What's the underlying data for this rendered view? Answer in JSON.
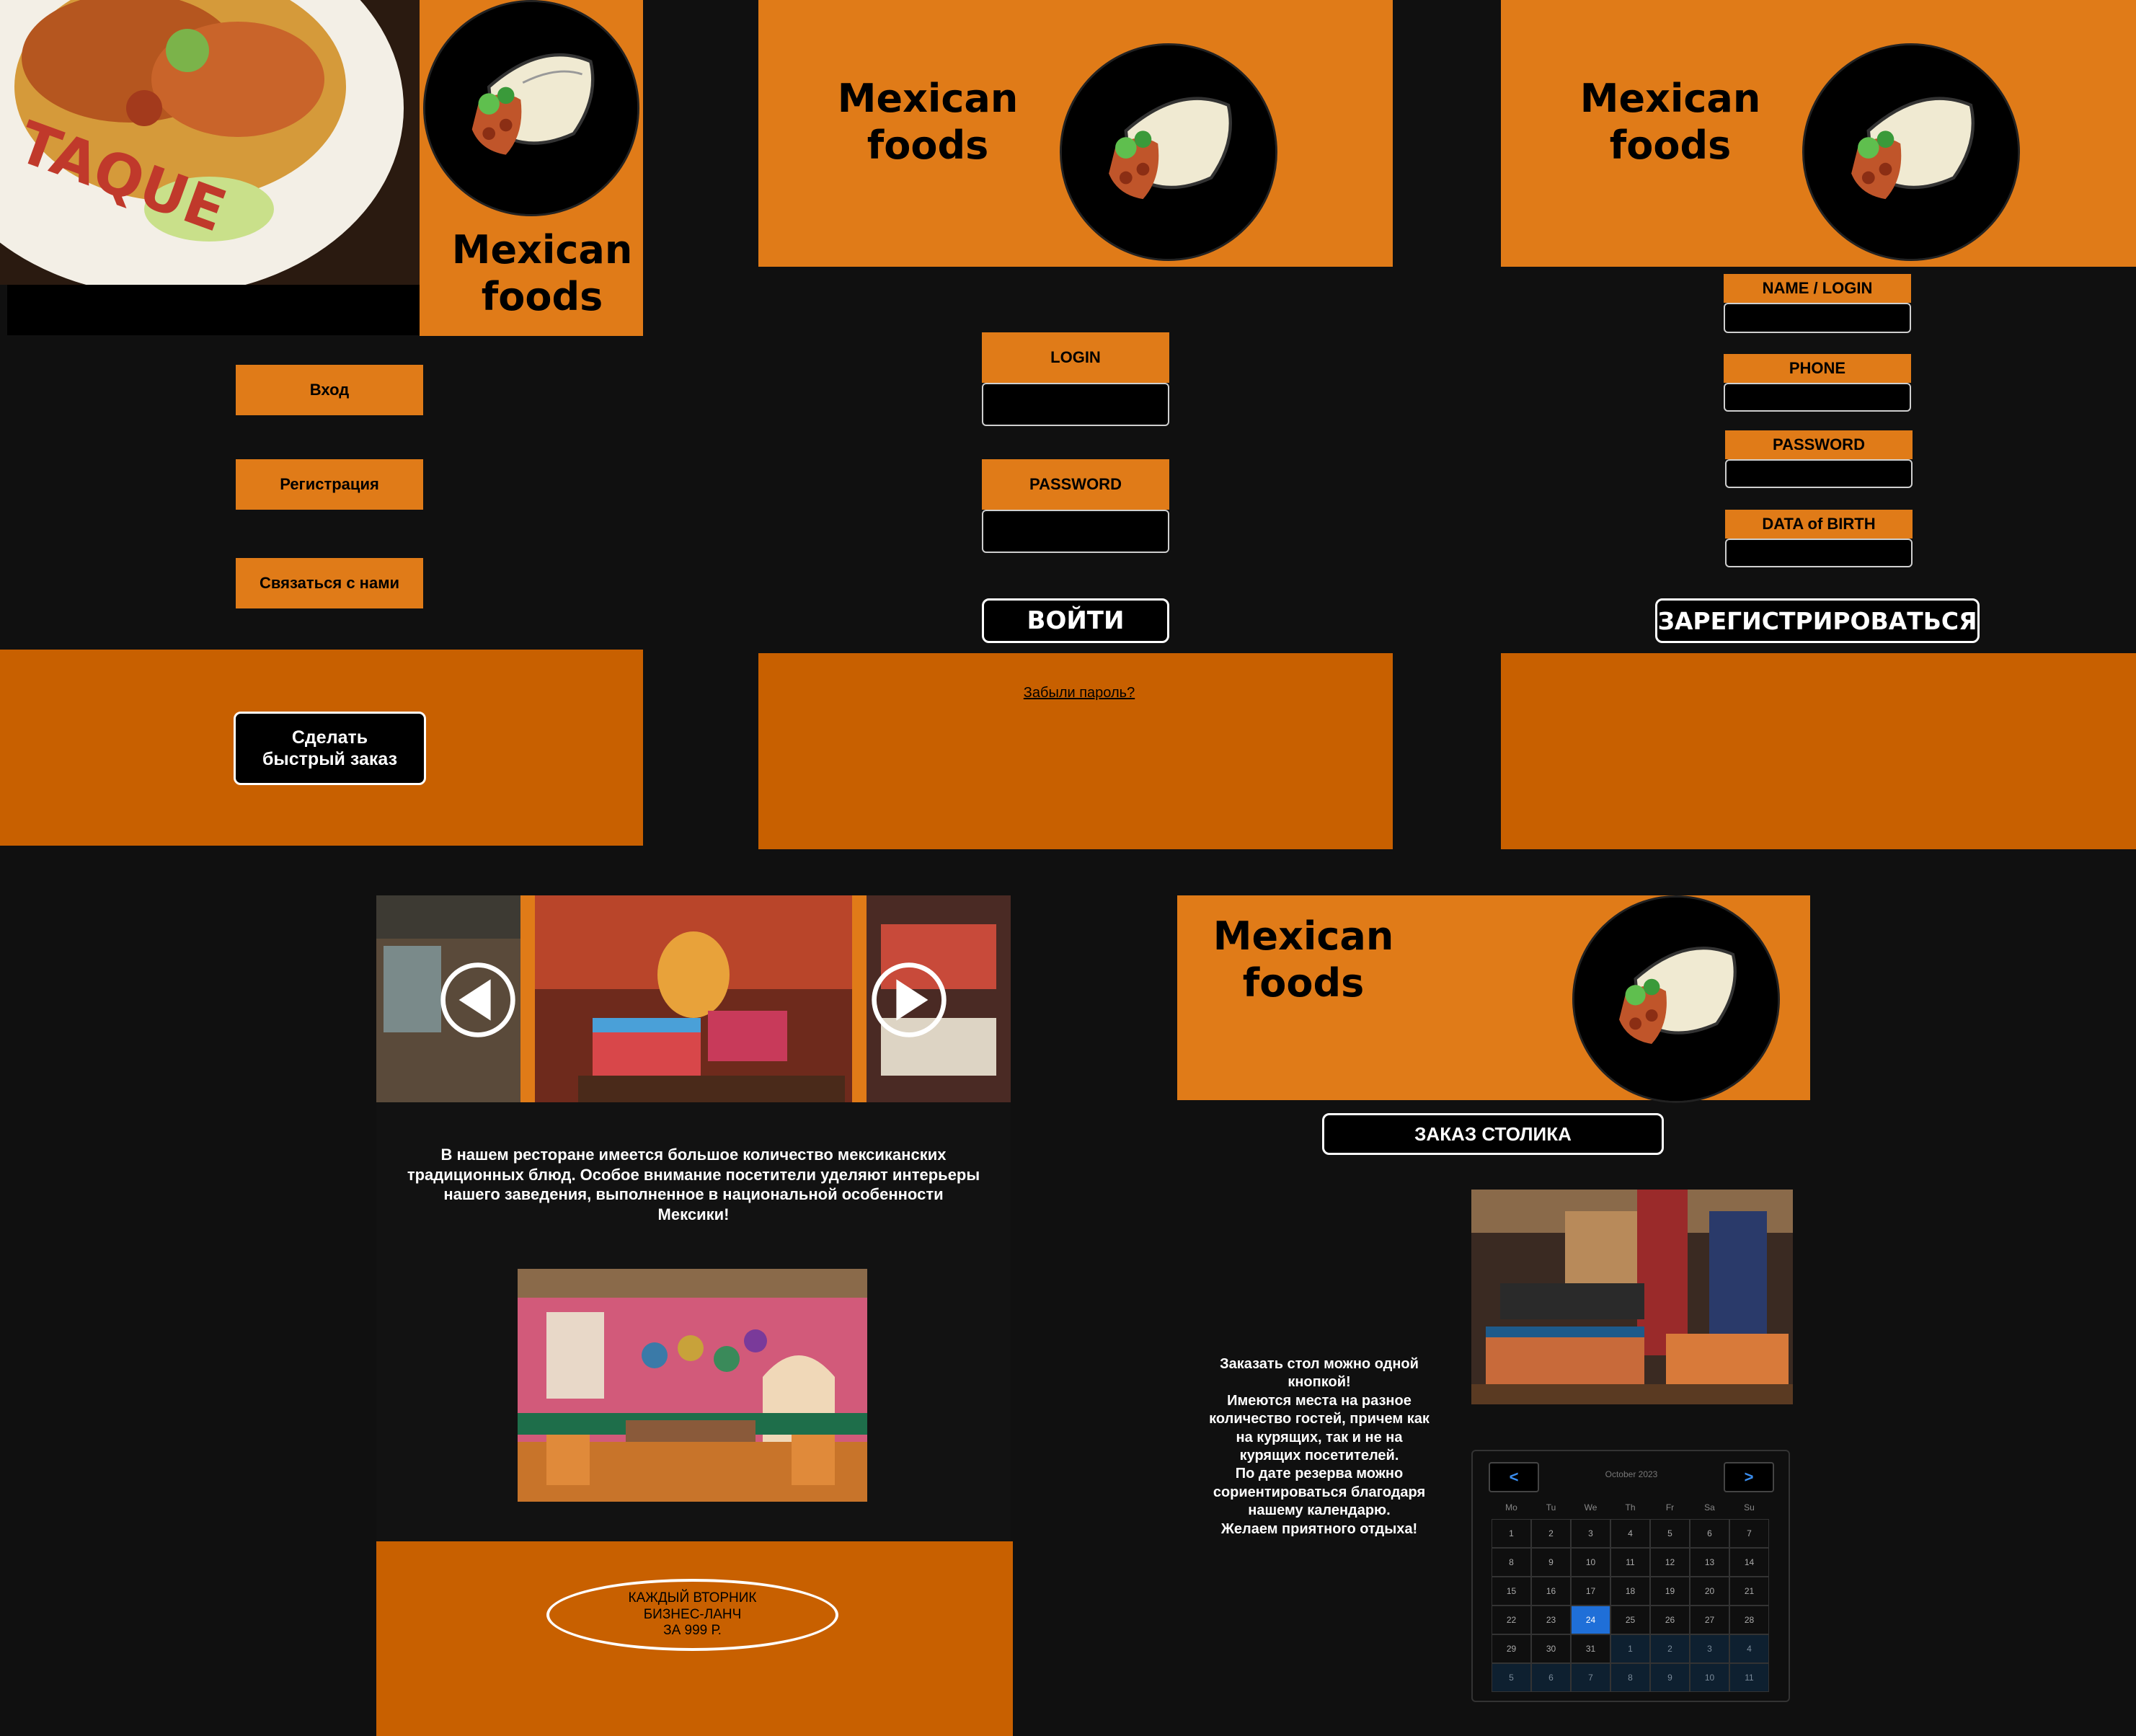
{
  "brand": {
    "line1": "Mexican",
    "line2": "foods"
  },
  "screen_home": {
    "menu": [
      "Вход",
      "Регистрация",
      "Связаться с нами"
    ],
    "quick_order": "Сделать быстрый заказ"
  },
  "screen_login": {
    "login_label": "LOGIN",
    "password_label": "PASSWORD",
    "submit": "ВОЙТИ",
    "forgot": "Забыли пароль?"
  },
  "screen_register": {
    "fields": [
      "NAME / LOGIN",
      "PHONE",
      "PASSWORD",
      "DATA of BIRTH"
    ],
    "submit": "ЗАРЕГИСТРИРОВАТЬСЯ"
  },
  "screen_about": {
    "description": "В нашем ресторане имеется большое количество мексиканских\nтрадиционных блюд. Особое внимание посетители уделяют интерьеры\nнашего заведения, выполненное в национальной особенности\nМексики!",
    "promo": "КАЖДЫЙ ВТОРНИК\nБИЗНЕС-ЛАНЧ\nЗА 999 Р."
  },
  "screen_booking": {
    "title_button": "ЗАКАЗ СТОЛИКА",
    "info": "Заказать стол можно одной\nкнопкой!\nИмеются места на разное\nколичество гостей, причем как\nна курящих, так и не на\nкурящих посетителей.\nПо дате резерва можно\nсориентироваться благодаря\nнашему календарю.\nЖелаем приятного отдыха!"
  },
  "calendar": {
    "month_label": "October 2023",
    "prev": "<",
    "next": ">",
    "weekdays": [
      "Mo",
      "Tu",
      "We",
      "Th",
      "Fr",
      "Sa",
      "Su"
    ],
    "selected_day": "24",
    "weeks": [
      [
        "1",
        "2",
        "3",
        "4",
        "5",
        "6",
        "7"
      ],
      [
        "8",
        "9",
        "10",
        "11",
        "12",
        "13",
        "14"
      ],
      [
        "15",
        "16",
        "17",
        "18",
        "19",
        "20",
        "21"
      ],
      [
        "22",
        "23",
        "24",
        "25",
        "26",
        "27",
        "28"
      ],
      [
        "29",
        "30",
        "31",
        "1",
        "2",
        "3",
        "4"
      ],
      [
        "5",
        "6",
        "7",
        "8",
        "9",
        "10",
        "11"
      ]
    ],
    "other_month_from": 31
  },
  "colors": {
    "orange": "#e07b18",
    "dark_orange": "#c86000",
    "background": "#101010",
    "accent_blue": "#1f6fd8"
  },
  "icons": [
    "burrito-logo-icon",
    "play-left-icon",
    "play-right-icon"
  ]
}
